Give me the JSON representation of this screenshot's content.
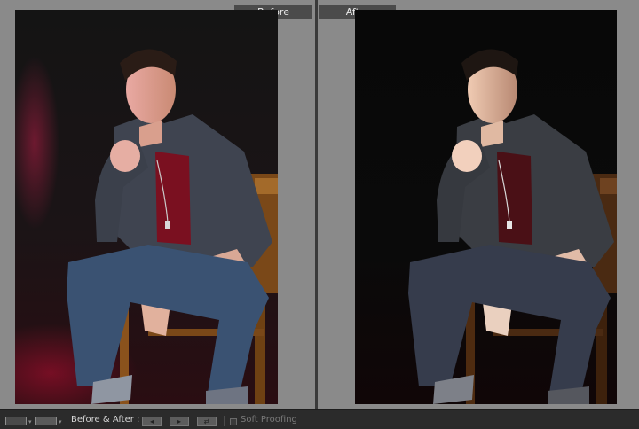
{
  "compare_view": {
    "before_label": "Before",
    "after_label": "After"
  },
  "toolbar": {
    "mode_label": "Before & After :",
    "soft_proofing_label": "Soft Proofing",
    "soft_proofing_checked": false
  },
  "colors": {
    "workspace_gray": "#7b7b7b",
    "toolbar_bg": "#2b2b2b",
    "accent_red": "#b8143c"
  }
}
